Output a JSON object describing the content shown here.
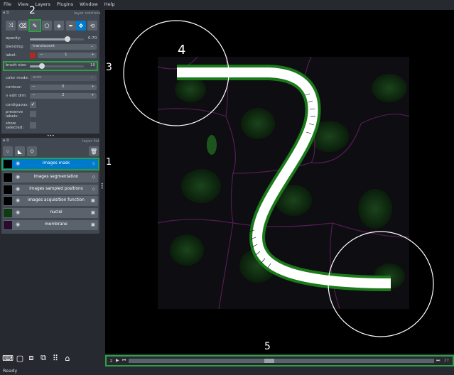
{
  "menu": [
    "File",
    "View",
    "Layers",
    "Plugins",
    "Window",
    "Help"
  ],
  "layer_controls": {
    "title": "layer controls",
    "opacity_label": "opacity:",
    "opacity_value": "0.70",
    "opacity_fraction": 0.7,
    "blending_label": "blending:",
    "blending_value": "translucent",
    "label_label": "label:",
    "label_color": "#b02a1e",
    "label_value": "1",
    "brush_size_label": "brush size:",
    "brush_size_value": "10",
    "brush_fraction": 0.23,
    "color_mode_label": "color mode:",
    "color_mode_value": "auto",
    "contour_label": "contour:",
    "contour_value": "0",
    "n_edit_dim_label": "n edit dim:",
    "n_edit_dim_value": "2",
    "contiguous_label": "contiguous:",
    "preserve_labels_label": "preserve labels:",
    "show_selected_label": "show selected:",
    "minus": "−",
    "plus": "+",
    "check": "✓"
  },
  "layer_list": {
    "title": "layer list",
    "layers": [
      {
        "name": "images mask",
        "selected": true,
        "type_icon": "label-icon",
        "thumb": "#000000"
      },
      {
        "name": "images segmentation",
        "selected": false,
        "type_icon": "label-icon",
        "thumb": "#000000"
      },
      {
        "name": "images sampled positions",
        "selected": false,
        "type_icon": "label-icon",
        "thumb": "#000000"
      },
      {
        "name": "images acquisition function",
        "selected": false,
        "type_icon": "image-icon",
        "thumb": "#000000"
      },
      {
        "name": "nuclei",
        "selected": false,
        "type_icon": "image-icon",
        "thumb": "#0f3a12"
      },
      {
        "name": "membrane",
        "selected": false,
        "type_icon": "image-icon",
        "thumb": "#2a0d2e"
      }
    ]
  },
  "callouts": {
    "c1": "1",
    "c2": "2",
    "c3": "3",
    "c4": "4",
    "c5": "5"
  },
  "dims": {
    "axis_label": "z",
    "play": "▶",
    "end_value": "27",
    "slider_fraction": 0.46
  },
  "status": "Ready",
  "colors": {
    "accent": "#007acc",
    "highlight": "#2ea043",
    "panel": "#414851",
    "background": "#262930",
    "stroke_outer": "#1a7a1a",
    "stroke_inner": "#ffffff",
    "nuclei": "#1d5a1d",
    "membrane": "#7a2a7a"
  }
}
